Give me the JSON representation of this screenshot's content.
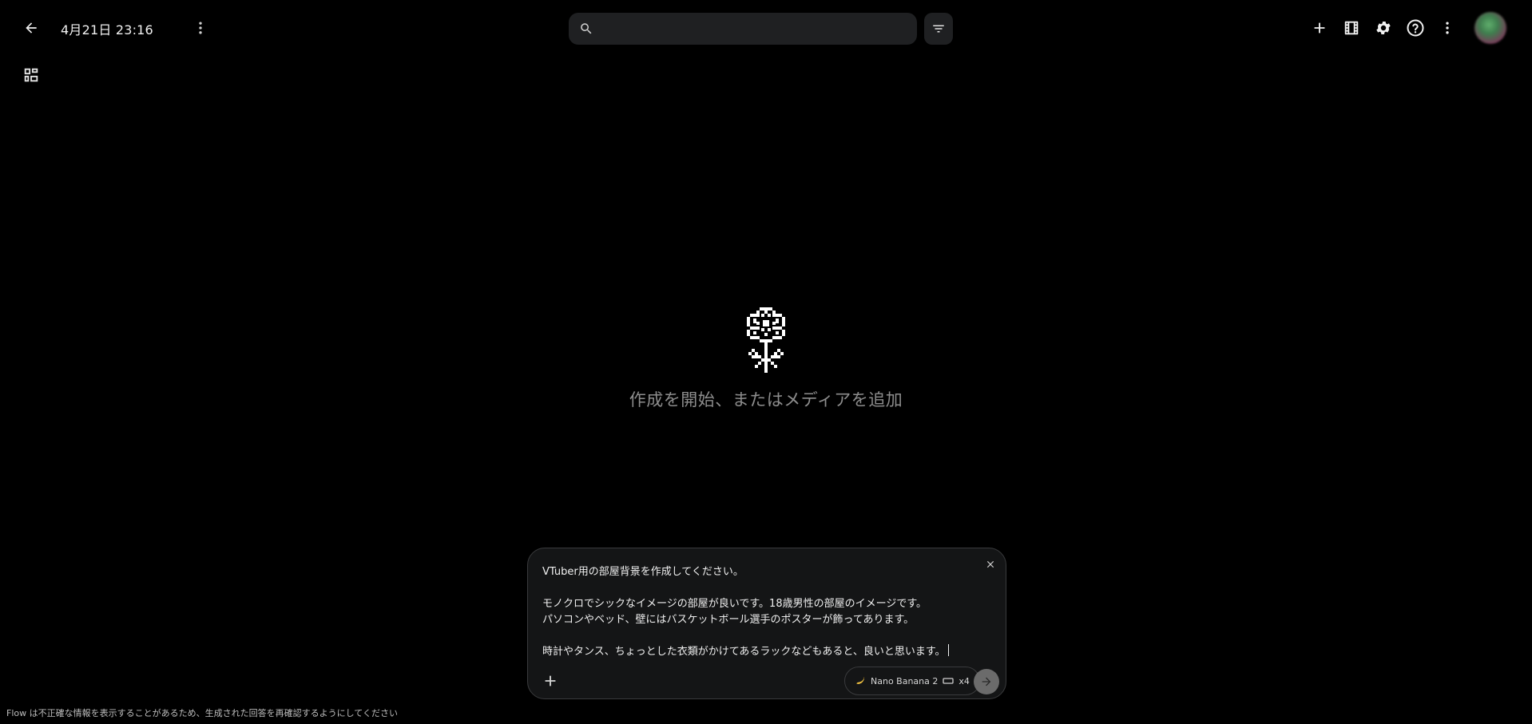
{
  "header": {
    "title": "4月21日 23:16",
    "search_placeholder": ""
  },
  "empty_state": {
    "message": "作成を開始、またはメディアを追加"
  },
  "prompt": {
    "text": "VTuber用の部屋背景を作成してください。\n\nモノクロでシックなイメージの部屋が良いです。18歳男性の部屋のイメージです。\nパソコンやベッド、壁にはバスケットボール選手のポスターが飾ってあります。\n\n時計やタンス、ちょっとした衣類がかけてあるラックなどもあると、良いと思います。",
    "model_name": "Nano Banana 2",
    "count": "x4"
  },
  "footer": {
    "disclaimer": "Flow は不正確な情報を表示することがあるため、生成された回答を再確認するようにしてください"
  },
  "icons": {
    "back": "arrow-left-icon",
    "more": "more-vert-icon",
    "grid": "dashboard-icon",
    "search": "search-icon",
    "filter": "filter-icon",
    "add": "plus-icon",
    "film": "film-icon",
    "settings": "gear-icon",
    "help": "help-icon",
    "flower": "pixel-flower-icon",
    "close": "close-icon",
    "send": "arrow-right-icon",
    "banana": "banana-icon",
    "aspect": "aspect-ratio-icon"
  },
  "colors": {
    "background": "#000000",
    "panel": "#141516",
    "search_bg": "#1f2022",
    "muted_text": "#8d8d8d"
  }
}
